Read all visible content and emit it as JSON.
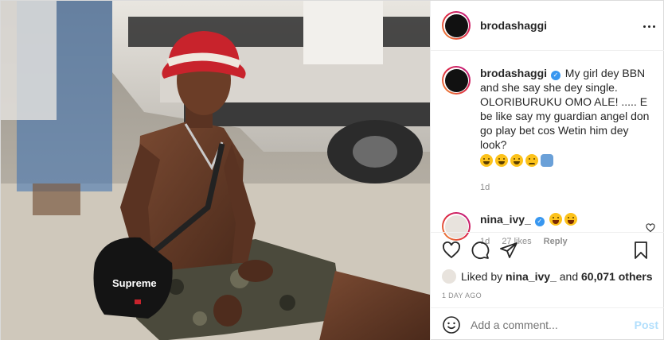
{
  "post": {
    "author": "brodashaggi",
    "caption": {
      "author": "brodashaggi",
      "text": "My girl dey BBN and she say she dey single. OLORIBURUKU OMO ALE! ..... E be like say my guardian angel don go play bet cos Wetin him dey look?",
      "emojis": [
        "weary-face",
        "weary-face",
        "weary-face",
        "pleading-face",
        "person-praying"
      ],
      "time": "1d"
    },
    "comments": [
      {
        "author": "nina_ivy_",
        "emojis": [
          "laughing-face",
          "laughing-face"
        ],
        "time": "1d",
        "likes": "27 likes",
        "reply_label": "Reply"
      }
    ],
    "liked_by_prefix": "Liked by",
    "liked_by_user": "nina_ivy_",
    "liked_by_suffix": "and",
    "liked_by_count": "60,071 others",
    "posted_ago": "1 DAY AGO",
    "add_comment_placeholder": "Add a comment...",
    "post_button": "Post"
  },
  "icons": {
    "more": "more-horizontal-icon",
    "verified": "verified-badge-icon",
    "like": "heart-icon",
    "comment": "comment-bubble-icon",
    "share": "paper-plane-icon",
    "save": "bookmark-icon",
    "emoji": "smiley-icon"
  },
  "colors": {
    "verified": "#3897f0",
    "post_button_disabled": "#b2dffc",
    "meta_text": "#8e8e8e",
    "story_ring_start": "#f09433",
    "story_ring_end": "#bc1888",
    "hat": "#c8232c"
  },
  "photo": {
    "graphic_text": "Supreme"
  }
}
